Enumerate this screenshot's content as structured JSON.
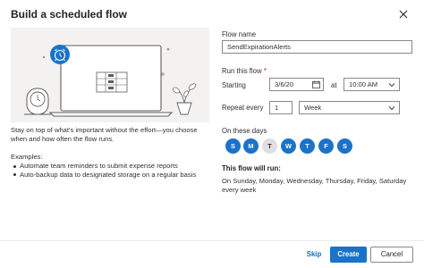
{
  "dialog": {
    "title": "Build a scheduled flow"
  },
  "intro": {
    "description": "Stay on top of what's important without the effort—you choose when and how often the flow runs.",
    "examples_label": "Examples:",
    "examples": [
      "Automate team reminders to submit expense reports",
      "Auto-backup data to designated storage on a regular basis"
    ]
  },
  "form": {
    "flow_name_label": "Flow name",
    "flow_name_value": "SendExpirationAlerts",
    "run_label": "Run this flow",
    "run_required_mark": "*",
    "starting_label": "Starting",
    "start_date": "3/6/20",
    "at_label": "at",
    "start_time": "10:00 AM",
    "repeat_label": "Repeat every",
    "repeat_count": "1",
    "repeat_unit": "Week",
    "days_label": "On these days",
    "days": [
      {
        "letter": "S",
        "selected": true
      },
      {
        "letter": "M",
        "selected": true
      },
      {
        "letter": "T",
        "selected": false
      },
      {
        "letter": "W",
        "selected": true
      },
      {
        "letter": "T",
        "selected": true
      },
      {
        "letter": "F",
        "selected": true
      },
      {
        "letter": "S",
        "selected": true
      }
    ],
    "will_run_label": "This flow will run:",
    "will_run_text": "On Sunday, Monday, Wednesday, Thursday, Friday, Saturday every week"
  },
  "footer": {
    "skip_label": "Skip",
    "create_label": "Create",
    "cancel_label": "Cancel"
  },
  "colors": {
    "accent": "#1a73c9",
    "day_off": "#e1dfdd",
    "illustration_bg": "#f3f2f1"
  },
  "icons": [
    "close-icon",
    "calendar-icon",
    "chevron-down-icon",
    "alarm-clock-icon",
    "laptop-illustration",
    "table-clock-illustration",
    "plant-illustration"
  ]
}
